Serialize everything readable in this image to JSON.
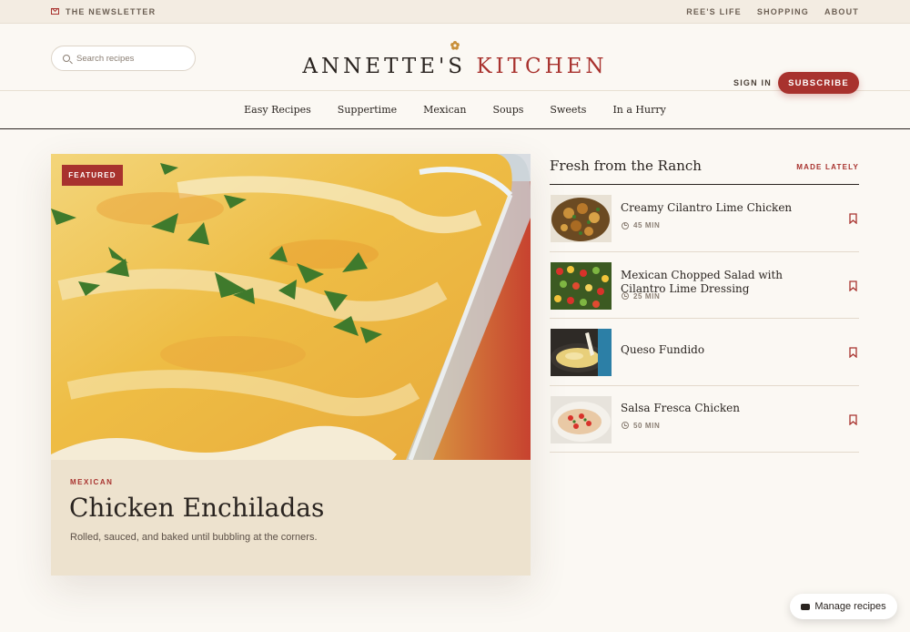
{
  "topbar": {
    "newsletter": "THE NEWSLETTER",
    "links": [
      "REE'S LIFE",
      "SHOPPING",
      "ABOUT"
    ]
  },
  "header": {
    "search_placeholder": "Search recipes",
    "logo_part1": "ANNETTE'S",
    "logo_part2": "KITCHEN",
    "sign_in": "SIGN IN",
    "subscribe": "SUBSCRIBE"
  },
  "nav": [
    "Easy Recipes",
    "Suppertime",
    "Mexican",
    "Soups",
    "Sweets",
    "In a Hurry"
  ],
  "featured": {
    "badge": "FEATURED",
    "category": "MEXICAN",
    "title": "Chicken Enchiladas",
    "description": "Rolled, sauced, and baked until bubbling at the corners."
  },
  "sidebar": {
    "title": "Fresh from the Ranch",
    "more": "MADE LATELY",
    "items": [
      {
        "title": "Creamy Cilantro Lime Chicken",
        "time": "45 MIN"
      },
      {
        "title": "Mexican Chopped Salad with Cilantro Lime Dressing",
        "time": "25 MIN"
      },
      {
        "title": "Queso Fundido",
        "time": ""
      },
      {
        "title": "Salsa Fresca Chicken",
        "time": "50 MIN"
      }
    ]
  },
  "manage": "Manage recipes",
  "colors": {
    "accent": "#a8322e",
    "background": "#fbf8f3",
    "card": "#ede2ce"
  }
}
